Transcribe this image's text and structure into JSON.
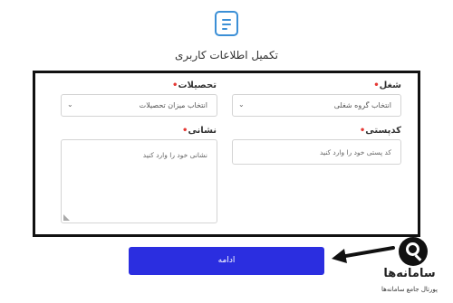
{
  "header": {
    "logo_icon": "document-list-icon",
    "title": "تکمیل اطلاعات کاربری"
  },
  "form": {
    "job": {
      "label": "شغل",
      "required_mark": "•",
      "value": "انتخاب گروه شغلی",
      "chevron": "⌄"
    },
    "education": {
      "label": "تحصیلات",
      "required_mark": "•",
      "value": "انتخاب میزان تحصیلات",
      "chevron": "⌄"
    },
    "postal_code": {
      "label": "کدپستی",
      "required_mark": "•",
      "placeholder": "کد پستی خود را وارد کنید"
    },
    "address": {
      "label": "نشانی",
      "required_mark": "•",
      "placeholder": "نشانی خود را وارد کنید"
    }
  },
  "actions": {
    "continue_label": "ادامه",
    "accent_color": "#2b2ee0"
  },
  "annotation": {
    "arrow_icon": "left-arrow-icon"
  },
  "watermark": {
    "icon": "magnifier-icon",
    "title": "سامانه‌ها",
    "subtitle": "پورتال جامع سامانه‌ها"
  }
}
